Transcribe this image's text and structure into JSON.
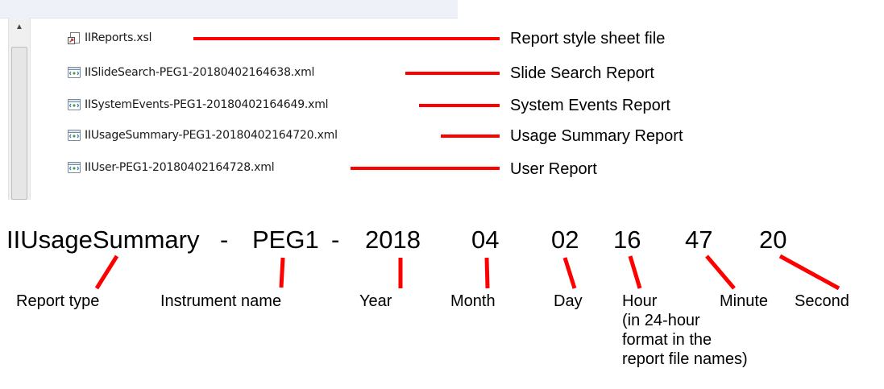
{
  "files": [
    {
      "name": "IIReports.xsl",
      "icon": "xsl-file-icon",
      "annotation": "Report style sheet file"
    },
    {
      "name": "IISlideSearch-PEG1-20180402164638.xml",
      "icon": "xml-file-icon",
      "annotation": "Slide Search Report"
    },
    {
      "name": "IISystemEvents-PEG1-20180402164649.xml",
      "icon": "xml-file-icon",
      "annotation": "System Events Report"
    },
    {
      "name": "IIUsageSummary-PEG1-20180402164720.xml",
      "icon": "xml-file-icon",
      "annotation": "Usage Summary Report"
    },
    {
      "name": "IIUser-PEG1-20180402164728.xml",
      "icon": "xml-file-icon",
      "annotation": "User Report"
    }
  ],
  "breakdown": {
    "segments": [
      {
        "text": "IIUsageSummary",
        "label": "Report type"
      },
      {
        "text": "PEG1",
        "label": "Instrument name"
      },
      {
        "text": "2018",
        "label": "Year"
      },
      {
        "text": "04",
        "label": "Month"
      },
      {
        "text": "02",
        "label": "Day"
      },
      {
        "text": "16",
        "label": "Hour"
      },
      {
        "text": "47",
        "label": "Minute"
      },
      {
        "text": "20",
        "label": "Second"
      }
    ],
    "separator_1": "-",
    "separator_2": "-",
    "hour_note": [
      "(in 24-hour",
      "format in the",
      "report file names)"
    ]
  },
  "colors": {
    "accent": "#ff0000"
  }
}
